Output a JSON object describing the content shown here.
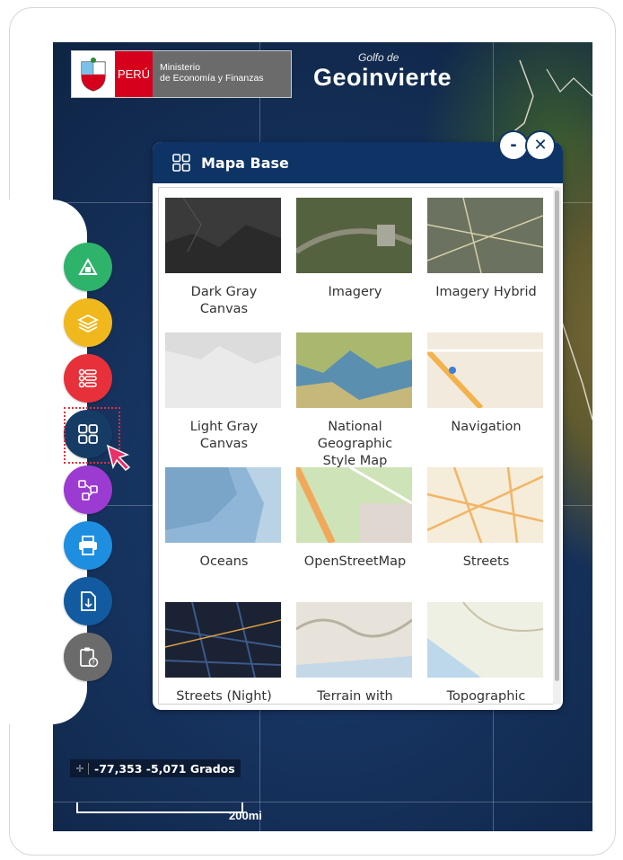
{
  "header": {
    "peru_label": "PERÚ",
    "ministry_line1": "Ministerio",
    "ministry_line2": "de Economía y Finanzas",
    "geo_top": "Golfo de",
    "geo_brand": "Geoinvierte"
  },
  "toolbar": {
    "buttons": [
      {
        "icon": "land-analysis-icon",
        "color": "#2eb36b"
      },
      {
        "icon": "layers-icon",
        "color": "#f1b81e"
      },
      {
        "icon": "legend-list-icon",
        "color": "#e8303a"
      },
      {
        "icon": "basemap-grid-icon",
        "color": "#163c66"
      },
      {
        "icon": "share-network-icon",
        "color": "#9b3bd1"
      },
      {
        "icon": "print-icon",
        "color": "#1e8fe0"
      },
      {
        "icon": "export-file-icon",
        "color": "#135ba0"
      },
      {
        "icon": "help-clipboard-icon",
        "color": "#6b6b6b"
      }
    ]
  },
  "basemap_panel": {
    "title": "Mapa Base",
    "minimize_label": "-",
    "close_label": "✕",
    "items": [
      {
        "label_lines": [
          "Dark Gray",
          "Canvas"
        ]
      },
      {
        "label_lines": [
          "Imagery"
        ]
      },
      {
        "label_lines": [
          "Imagery Hybrid"
        ]
      },
      {
        "label_lines": [
          "Light Gray",
          "Canvas"
        ]
      },
      {
        "label_lines": [
          "National",
          "Geographic",
          "Style Map"
        ]
      },
      {
        "label_lines": [
          "Navigation"
        ]
      },
      {
        "label_lines": [
          "Oceans"
        ]
      },
      {
        "label_lines": [
          "OpenStreetMap"
        ]
      },
      {
        "label_lines": [
          "Streets"
        ]
      },
      {
        "label_lines": [
          "Streets (Night)"
        ]
      },
      {
        "label_lines": [
          "Terrain with"
        ]
      },
      {
        "label_lines": [
          "Topographic"
        ]
      }
    ]
  },
  "status": {
    "coordinates": "-77,353 -5,071 Grados",
    "scale": "200mi"
  }
}
